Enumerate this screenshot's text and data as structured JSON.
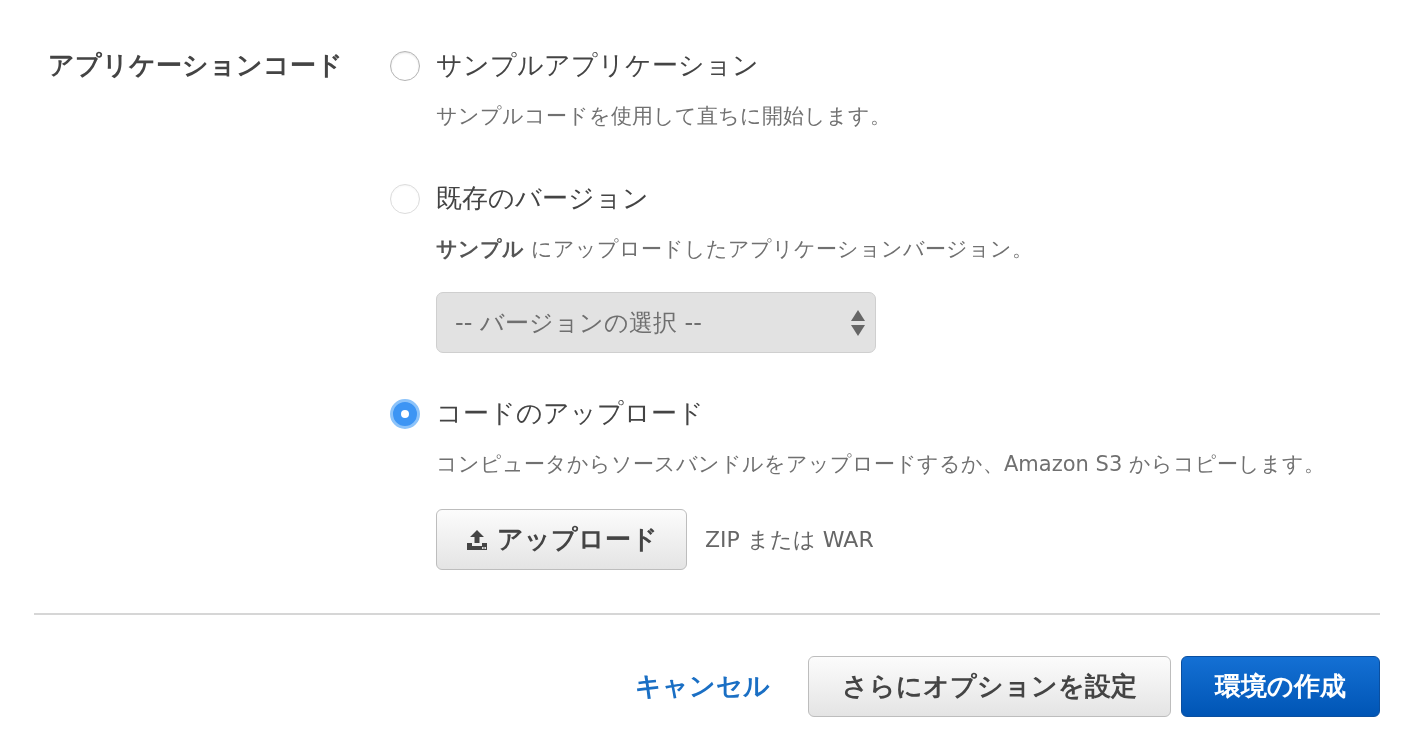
{
  "field": {
    "label": "アプリケーションコード"
  },
  "options": [
    {
      "kind": "simple",
      "label": "サンプルアプリケーション",
      "description": "サンプルコードを使用して直ちに開始します。",
      "selected": false,
      "disabled": false
    },
    {
      "kind": "version",
      "label": "既存のバージョン",
      "description": "**サンプル** にアップロードしたアプリケーションバージョン。",
      "selected": false,
      "disabled": true,
      "select": {
        "value": "-- バージョンの選択 --",
        "disabled": true
      }
    },
    {
      "kind": "upload",
      "label": "コードのアップロード",
      "description": "コンピュータからソースバンドルをアップロードするか、Amazon S3 からコピーします。",
      "selected": true,
      "disabled": false,
      "upload_button": "アップロード",
      "hint": "ZIP または WAR"
    }
  ],
  "actions": {
    "cancel": "キャンセル",
    "buttons": [
      {
        "kind": "secondary",
        "label": "さらにオプションを設定"
      },
      {
        "kind": "primary",
        "label": "環境の作成"
      }
    ]
  }
}
